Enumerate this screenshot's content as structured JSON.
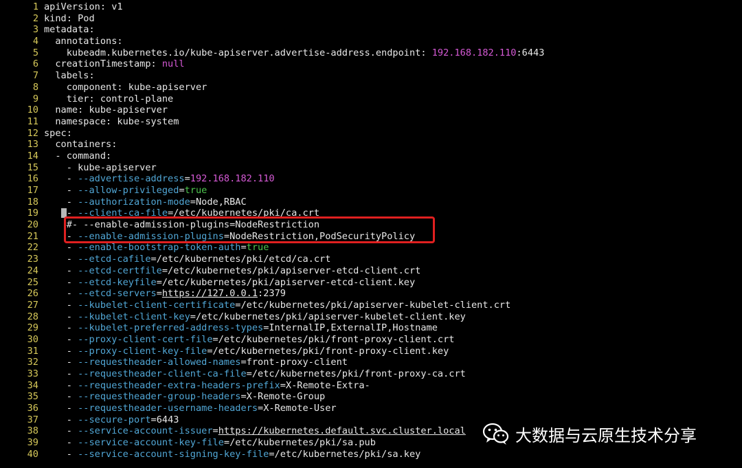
{
  "lines": [
    {
      "n": "1",
      "parts": [
        {
          "t": "apiVersion: v1",
          "c": "key"
        }
      ]
    },
    {
      "n": "2",
      "parts": [
        {
          "t": "kind: Pod",
          "c": "key"
        }
      ]
    },
    {
      "n": "3",
      "parts": [
        {
          "t": "metadata:",
          "c": "key"
        }
      ]
    },
    {
      "n": "4",
      "parts": [
        {
          "t": "  annotations:",
          "c": "key"
        }
      ]
    },
    {
      "n": "5",
      "parts": [
        {
          "t": "    kubeadm.kubernetes.io/kube-apiserver.advertise-address.endpoint: ",
          "c": "key"
        },
        {
          "t": "192.168.182.110",
          "c": "num"
        },
        {
          "t": ":6443",
          "c": "val"
        }
      ]
    },
    {
      "n": "6",
      "parts": [
        {
          "t": "  creationTimestamp: ",
          "c": "key"
        },
        {
          "t": "null",
          "c": "kw"
        }
      ]
    },
    {
      "n": "7",
      "parts": [
        {
          "t": "  labels:",
          "c": "key"
        }
      ]
    },
    {
      "n": "8",
      "parts": [
        {
          "t": "    component: kube-apiserver",
          "c": "key"
        }
      ]
    },
    {
      "n": "9",
      "parts": [
        {
          "t": "    tier: control-plane",
          "c": "key"
        }
      ]
    },
    {
      "n": "10",
      "parts": [
        {
          "t": "  name: kube-apiserver",
          "c": "key"
        }
      ]
    },
    {
      "n": "11",
      "parts": [
        {
          "t": "  namespace: kube-system",
          "c": "key"
        }
      ]
    },
    {
      "n": "12",
      "parts": [
        {
          "t": "spec:",
          "c": "key"
        }
      ]
    },
    {
      "n": "13",
      "parts": [
        {
          "t": "  containers:",
          "c": "key"
        }
      ]
    },
    {
      "n": "14",
      "parts": [
        {
          "t": "  - command:",
          "c": "key"
        }
      ]
    },
    {
      "n": "15",
      "parts": [
        {
          "t": "    - kube-apiserver",
          "c": "key"
        }
      ]
    },
    {
      "n": "16",
      "parts": [
        {
          "t": "    - ",
          "c": "val"
        },
        {
          "t": "--advertise-address",
          "c": "flag"
        },
        {
          "t": "=",
          "c": "val"
        },
        {
          "t": "192.168.182.110",
          "c": "num"
        }
      ]
    },
    {
      "n": "17",
      "parts": [
        {
          "t": "    - ",
          "c": "val"
        },
        {
          "t": "--allow-privileged",
          "c": "flag"
        },
        {
          "t": "=",
          "c": "val"
        },
        {
          "t": "true",
          "c": "bool"
        }
      ]
    },
    {
      "n": "18",
      "parts": [
        {
          "t": "    - ",
          "c": "val"
        },
        {
          "t": "--authorization-mode",
          "c": "flag"
        },
        {
          "t": "=Node,RBAC",
          "c": "val"
        }
      ]
    },
    {
      "n": "19",
      "parts": [
        {
          "t": "    - ",
          "c": "val"
        },
        {
          "t": "--client-ca-file",
          "c": "flag"
        },
        {
          "t": "=/etc/kubernetes/pki/ca.crt",
          "c": "val"
        }
      ],
      "cursor": true
    },
    {
      "n": "20",
      "parts": [
        {
          "t": "    #- --enable-admission-plugins=NodeRestriction",
          "c": "val"
        }
      ]
    },
    {
      "n": "21",
      "parts": [
        {
          "t": "    - ",
          "c": "val"
        },
        {
          "t": "--enable-admission-plugins",
          "c": "flag"
        },
        {
          "t": "=NodeRestriction,PodSecurityPolicy",
          "c": "val"
        }
      ]
    },
    {
      "n": "22",
      "parts": [
        {
          "t": "    - ",
          "c": "val"
        },
        {
          "t": "--enable-bootstrap-token-auth",
          "c": "flag"
        },
        {
          "t": "=",
          "c": "val"
        },
        {
          "t": "true",
          "c": "bool"
        }
      ]
    },
    {
      "n": "23",
      "parts": [
        {
          "t": "    - ",
          "c": "val"
        },
        {
          "t": "--etcd-cafile",
          "c": "flag"
        },
        {
          "t": "=/etc/kubernetes/pki/etcd/ca.crt",
          "c": "val"
        }
      ]
    },
    {
      "n": "24",
      "parts": [
        {
          "t": "    - ",
          "c": "val"
        },
        {
          "t": "--etcd-certfile",
          "c": "flag"
        },
        {
          "t": "=/etc/kubernetes/pki/apiserver-etcd-client.crt",
          "c": "val"
        }
      ]
    },
    {
      "n": "25",
      "parts": [
        {
          "t": "    - ",
          "c": "val"
        },
        {
          "t": "--etcd-keyfile",
          "c": "flag"
        },
        {
          "t": "=/etc/kubernetes/pki/apiserver-etcd-client.key",
          "c": "val"
        }
      ]
    },
    {
      "n": "26",
      "parts": [
        {
          "t": "    - ",
          "c": "val"
        },
        {
          "t": "--etcd-servers",
          "c": "flag"
        },
        {
          "t": "=",
          "c": "val"
        },
        {
          "t": "https://127.0.0.1",
          "c": "url"
        },
        {
          "t": ":2379",
          "c": "val"
        }
      ]
    },
    {
      "n": "27",
      "parts": [
        {
          "t": "    - ",
          "c": "val"
        },
        {
          "t": "--kubelet-client-certificate",
          "c": "flag"
        },
        {
          "t": "=/etc/kubernetes/pki/apiserver-kubelet-client.crt",
          "c": "val"
        }
      ]
    },
    {
      "n": "28",
      "parts": [
        {
          "t": "    - ",
          "c": "val"
        },
        {
          "t": "--kubelet-client-key",
          "c": "flag"
        },
        {
          "t": "=/etc/kubernetes/pki/apiserver-kubelet-client.key",
          "c": "val"
        }
      ]
    },
    {
      "n": "29",
      "parts": [
        {
          "t": "    - ",
          "c": "val"
        },
        {
          "t": "--kubelet-preferred-address-types",
          "c": "flag"
        },
        {
          "t": "=InternalIP,ExternalIP,Hostname",
          "c": "val"
        }
      ]
    },
    {
      "n": "30",
      "parts": [
        {
          "t": "    - ",
          "c": "val"
        },
        {
          "t": "--proxy-client-cert-file",
          "c": "flag"
        },
        {
          "t": "=/etc/kubernetes/pki/front-proxy-client.crt",
          "c": "val"
        }
      ]
    },
    {
      "n": "31",
      "parts": [
        {
          "t": "    - ",
          "c": "val"
        },
        {
          "t": "--proxy-client-key-file",
          "c": "flag"
        },
        {
          "t": "=/etc/kubernetes/pki/front-proxy-client.key",
          "c": "val"
        }
      ]
    },
    {
      "n": "32",
      "parts": [
        {
          "t": "    - ",
          "c": "val"
        },
        {
          "t": "--requestheader-allowed-names",
          "c": "flag"
        },
        {
          "t": "=front-proxy-client",
          "c": "val"
        }
      ]
    },
    {
      "n": "33",
      "parts": [
        {
          "t": "    - ",
          "c": "val"
        },
        {
          "t": "--requestheader-client-ca-file",
          "c": "flag"
        },
        {
          "t": "=/etc/kubernetes/pki/front-proxy-ca.crt",
          "c": "val"
        }
      ]
    },
    {
      "n": "34",
      "parts": [
        {
          "t": "    - ",
          "c": "val"
        },
        {
          "t": "--requestheader-extra-headers-prefix",
          "c": "flag"
        },
        {
          "t": "=X-Remote-Extra-",
          "c": "val"
        }
      ]
    },
    {
      "n": "35",
      "parts": [
        {
          "t": "    - ",
          "c": "val"
        },
        {
          "t": "--requestheader-group-headers",
          "c": "flag"
        },
        {
          "t": "=X-Remote-Group",
          "c": "val"
        }
      ]
    },
    {
      "n": "36",
      "parts": [
        {
          "t": "    - ",
          "c": "val"
        },
        {
          "t": "--requestheader-username-headers",
          "c": "flag"
        },
        {
          "t": "=X-Remote-User",
          "c": "val"
        }
      ]
    },
    {
      "n": "37",
      "parts": [
        {
          "t": "    - ",
          "c": "val"
        },
        {
          "t": "--secure-port",
          "c": "flag"
        },
        {
          "t": "=6443",
          "c": "val"
        }
      ]
    },
    {
      "n": "38",
      "parts": [
        {
          "t": "    - ",
          "c": "val"
        },
        {
          "t": "--service-account-issuer",
          "c": "flag"
        },
        {
          "t": "=",
          "c": "val"
        },
        {
          "t": "https://kubernetes.default.svc.cluster.local",
          "c": "url"
        }
      ]
    },
    {
      "n": "39",
      "parts": [
        {
          "t": "    - ",
          "c": "val"
        },
        {
          "t": "--service-account-key-file",
          "c": "flag"
        },
        {
          "t": "=/etc/kubernetes/pki/sa.pub",
          "c": "val"
        }
      ]
    },
    {
      "n": "40",
      "parts": [
        {
          "t": "    - ",
          "c": "val"
        },
        {
          "t": "--service-account-signing-key-file",
          "c": "flag"
        },
        {
          "t": "=/etc/kubernetes/pki/sa.key",
          "c": "val"
        }
      ]
    }
  ],
  "watermark": {
    "text": "大数据与云原生技术分享",
    "icon": "wechat-icon"
  },
  "colors": {
    "background": "#000000",
    "line_number": "#d7c95a",
    "text": "#e8e8e8",
    "flag": "#51a7d6",
    "number": "#d65ad6",
    "boolean": "#4ec54e",
    "highlight_box": "#e02020"
  }
}
